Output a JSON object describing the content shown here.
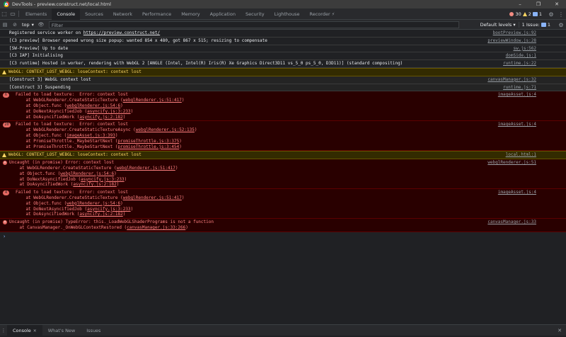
{
  "window": {
    "title": "DevTools - preview.construct.net/local.html",
    "controls": [
      "–",
      "❐",
      "✕"
    ]
  },
  "tabs": [
    "Elements",
    "Console",
    "Sources",
    "Network",
    "Performance",
    "Memory",
    "Application",
    "Security",
    "Lighthouse",
    "Recorder ⚡"
  ],
  "active_tab": "Console",
  "counts": {
    "errors": "30",
    "warnings": "2",
    "messages": "1"
  },
  "toolbar": {
    "context": "top",
    "filter_placeholder": "Filter",
    "levels": "Default levels",
    "issues": "1 Issue:",
    "issues_count": "1"
  },
  "colors": {
    "error_bg": "#290000",
    "error_text": "#ff8080",
    "warn_bg": "#332b00",
    "warn_text": "#fdd663"
  },
  "messages": [
    {
      "type": "info",
      "lines": [
        [
          "Registered service worker on ",
          {
            "link": "https://preview.construct.net/"
          }
        ]
      ],
      "source": "bootPreview.js:92"
    },
    {
      "type": "info",
      "lines": [
        [
          "[C3 preview] Browser opened wrong size popup: wanted 854 x 480, got 867 x 515; resizing to compensate"
        ]
      ],
      "source": "previewWindow.js:28"
    },
    {
      "type": "info",
      "lines": [
        [
          "[SW-Preview] Up to date"
        ]
      ],
      "source": "sw.js:562"
    },
    {
      "type": "info",
      "lines": [
        [
          "[C3 IAP] Initialising"
        ]
      ],
      "source": "domSide.js:1"
    },
    {
      "type": "info",
      "lines": [
        [
          "[C3 runtime] Hosted in worker, rendering with WebGL 2 [ANGLE (Intel, Intel(R) Iris(R) Xe Graphics Direct3D11 vs_5_0 ps_5_0, D3D11)] (standard compositing)"
        ]
      ],
      "source": "runtime.js:22"
    },
    {
      "type": "warn",
      "lines": [
        [
          "WebGL: CONTEXT_LOST_WEBGL: loseContext: context lost"
        ]
      ],
      "source": ""
    },
    {
      "type": "plain",
      "lines": [
        [
          "[Construct 3] WebGL context lost"
        ]
      ],
      "source": "canvasManager.js:32"
    },
    {
      "type": "plain",
      "lines": [
        [
          "[Construct 3] Suspending"
        ]
      ],
      "source": "runtime.js:71"
    },
    {
      "type": "err",
      "badge": "6",
      "lines": [
        [
          "Failed to load texture:  Error: context lost"
        ],
        [
          "    at WebGLRenderer.CreateStaticTexture (",
          {
            "link": "webglRenderer.js:51:417"
          },
          ")"
        ],
        [
          "    at Object.func (",
          {
            "link": "webglRenderer.js:54:6"
          },
          ")"
        ],
        [
          "    at DoNextAsyncifiedJob (",
          {
            "link": "asyncify.js:3:233"
          },
          ")"
        ],
        [
          "    at DoAsyncifiedWork (",
          {
            "link": "asyncify.js:2:182"
          },
          ")"
        ]
      ],
      "source": "imageAsset.js:4"
    },
    {
      "type": "err",
      "badge": "20",
      "lines": [
        [
          "Failed to load texture:  Error: context lost"
        ],
        [
          "    at WebGLRenderer.CreateStaticTextureAsync (",
          {
            "link": "webglRenderer.js:52:135"
          },
          ")"
        ],
        [
          "    at Object.func (",
          {
            "link": "imageAsset.js:3:393"
          },
          ")"
        ],
        [
          "    at PromiseThrottle._MaybeStartNext (",
          {
            "link": "promiseThrottle.js:3:375"
          },
          ")"
        ],
        [
          "    at PromiseThrottle._MaybeStartNext (",
          {
            "link": "promiseThrottle.js:3:454"
          },
          ")"
        ]
      ],
      "source": "imageAsset.js:4"
    },
    {
      "type": "warn",
      "lines": [
        [
          "WebGL: CONTEXT_LOST_WEBGL: loseContext: context lost"
        ]
      ],
      "source": "local.html:1"
    },
    {
      "type": "err",
      "icon": true,
      "lines": [
        [
          "Uncaught (in promise) Error: context lost"
        ],
        [
          "    at WebGLRenderer.CreateStaticTexture (",
          {
            "link": "webglRenderer.js:51:417"
          },
          ")"
        ],
        [
          "    at Object.func (",
          {
            "link": "webglRenderer.js:54:6"
          },
          ")"
        ],
        [
          "    at DoNextAsyncifiedJob (",
          {
            "link": "asyncify.js:3:233"
          },
          ")"
        ],
        [
          "    at DoAsyncifiedWork (",
          {
            "link": "asyncify.js:2:182"
          },
          ")"
        ]
      ],
      "source": "webglRenderer.js:51"
    },
    {
      "type": "err",
      "badge": "4",
      "lines": [
        [
          "Failed to load texture:  Error: context lost"
        ],
        [
          "    at WebGLRenderer.CreateStaticTexture (",
          {
            "link": "webglRenderer.js:51:417"
          },
          ")"
        ],
        [
          "    at Object.func (",
          {
            "link": "webglRenderer.js:54:6"
          },
          ")"
        ],
        [
          "    at DoNextAsyncifiedJob (",
          {
            "link": "asyncify.js:3:233"
          },
          ")"
        ],
        [
          "    at DoAsyncifiedWork (",
          {
            "link": "asyncify.js:2:182"
          },
          ")"
        ]
      ],
      "source": "imageAsset.js:4"
    },
    {
      "type": "err",
      "icon": true,
      "lines": [
        [
          "Uncaught (in promise) TypeError: this._LoadWebGLShaderPrograms is not a function"
        ],
        [
          "    at CanvasManager._OnWebGLContextRestored (",
          {
            "link": "canvasManager.js:33:266"
          },
          ")"
        ]
      ],
      "source": "canvasManager.js:33"
    }
  ],
  "prompt": "›",
  "drawer": {
    "tabs": [
      "Console",
      "What's New",
      "Issues"
    ],
    "active": "Console",
    "close": "✕",
    "menu": "⋮"
  }
}
